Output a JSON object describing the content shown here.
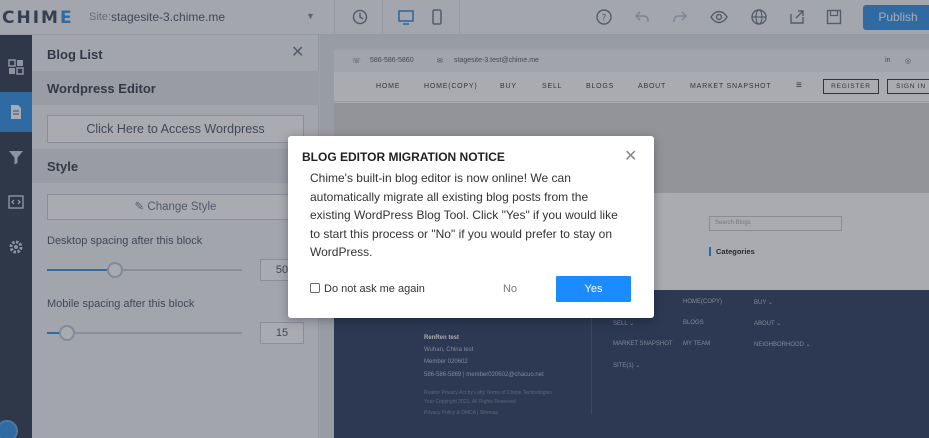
{
  "app": {
    "logo_main": "CHIM",
    "logo_accent": "E"
  },
  "topbar": {
    "site_label": "Site:",
    "site_name": "stagesite-3.chime.me",
    "publish_label": "Publish",
    "icons": [
      "history-icon",
      "desktop-icon",
      "mobile-icon",
      "help-icon",
      "undo-icon",
      "redo-icon",
      "preview-eye-icon",
      "globe-icon",
      "export-icon",
      "save-icon"
    ]
  },
  "rail": {
    "items": [
      "layout-icon",
      "page-icon",
      "filter-icon",
      "code-icon",
      "settings-icon"
    ]
  },
  "panel": {
    "title": "Blog List",
    "wordpress_section": "Wordpress Editor",
    "wordpress_button": "Click Here to Access Wordpress",
    "style_section": "Style",
    "style_button": "Change Style",
    "desktop_label": "Desktop spacing after this block",
    "desktop_value": "50",
    "desktop_level": 0.35,
    "mobile_label": "Mobile spacing after this block",
    "mobile_value": "15",
    "mobile_level": 0.1
  },
  "site": {
    "phone": "586-586-5860",
    "email": "stagesite-3.test@chime.me",
    "nav": [
      "HOME",
      "HOME(COPY)",
      "BUY",
      "SELL",
      "BLOGS",
      "ABOUT",
      "MARKET SNAPSHOT"
    ],
    "register": "REGISTER",
    "signin": "SIGN IN",
    "search_placeholder": "Search Blogs",
    "categories": "Categories",
    "footer": {
      "name": "RenRen test",
      "address": "Wuhan, China test",
      "member": "Member 020602",
      "contact": "586-586-5869   |   member020602@chacuo.net",
      "copyright": "Realtor Privacy Act by Lofty Terms of Chime Technologies",
      "copyright2": "Your Copyright 2021. All Rights Reserved",
      "policy": "Privacy Policy & DMCA | Sitemap",
      "links": [
        "HOME(COPY)",
        "BUY ⌄",
        "SELL ⌄",
        "BLOGS",
        "ABOUT ⌄",
        "MARKET SNAPSHOT",
        "MY TEAM",
        "NEIGHBORHOOD ⌄",
        "SITE(1) ⌄"
      ]
    }
  },
  "modal": {
    "title": "BLOG EDITOR MIGRATION NOTICE",
    "body": "Chime's built-in blog editor is now online! We can automatically migrate all existing blog posts from the existing WordPress Blog Tool. Click \"Yes\" if you would like to start this process or \"No\" if you would prefer to stay on WordPress.",
    "checkbox_label": "Do not ask me again",
    "no_label": "No",
    "yes_label": "Yes"
  }
}
